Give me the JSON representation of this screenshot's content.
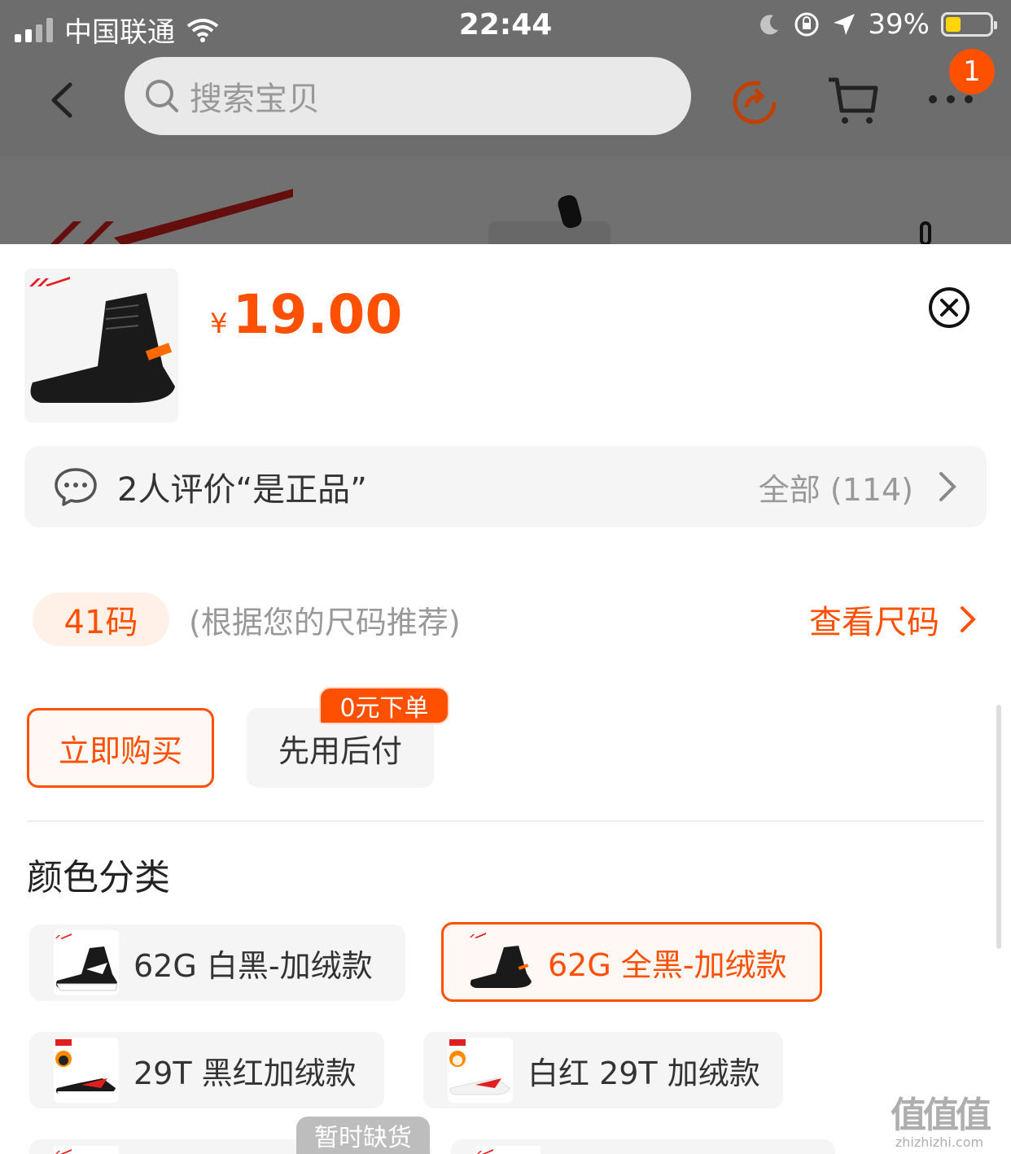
{
  "status_bar": {
    "carrier": "中国联通",
    "time": "22:44",
    "battery": "39%"
  },
  "nav": {
    "search_placeholder": "搜索宝贝",
    "badge_count": "1"
  },
  "product": {
    "currency": "¥",
    "price": "19.00"
  },
  "review": {
    "text": "2人评价“是正品”",
    "all_label": "全部 (114)"
  },
  "size": {
    "recommended": "41码",
    "note": "(根据您的尺码推荐)",
    "view_link": "查看尺码"
  },
  "purchase": {
    "buy_now": "立即购买",
    "pay_later": "先用后付",
    "pay_later_tag": "0元下单"
  },
  "color_section": {
    "title": "颜色分类",
    "options": [
      {
        "label": "62G 白黑-加绒款",
        "selected": false
      },
      {
        "label": "62G 全黑-加绒款",
        "selected": true
      },
      {
        "label": "29T 黑红加绒款",
        "selected": false
      },
      {
        "label": "白红 29T 加绒款",
        "selected": false
      }
    ],
    "soldout_tag": "暂时缺货"
  },
  "watermark": {
    "big": "值值值",
    "small": "zhizhizhi.com"
  },
  "colors": {
    "accent": "#ff5000",
    "overlay": "rgba(0,0,0,0.55)"
  }
}
